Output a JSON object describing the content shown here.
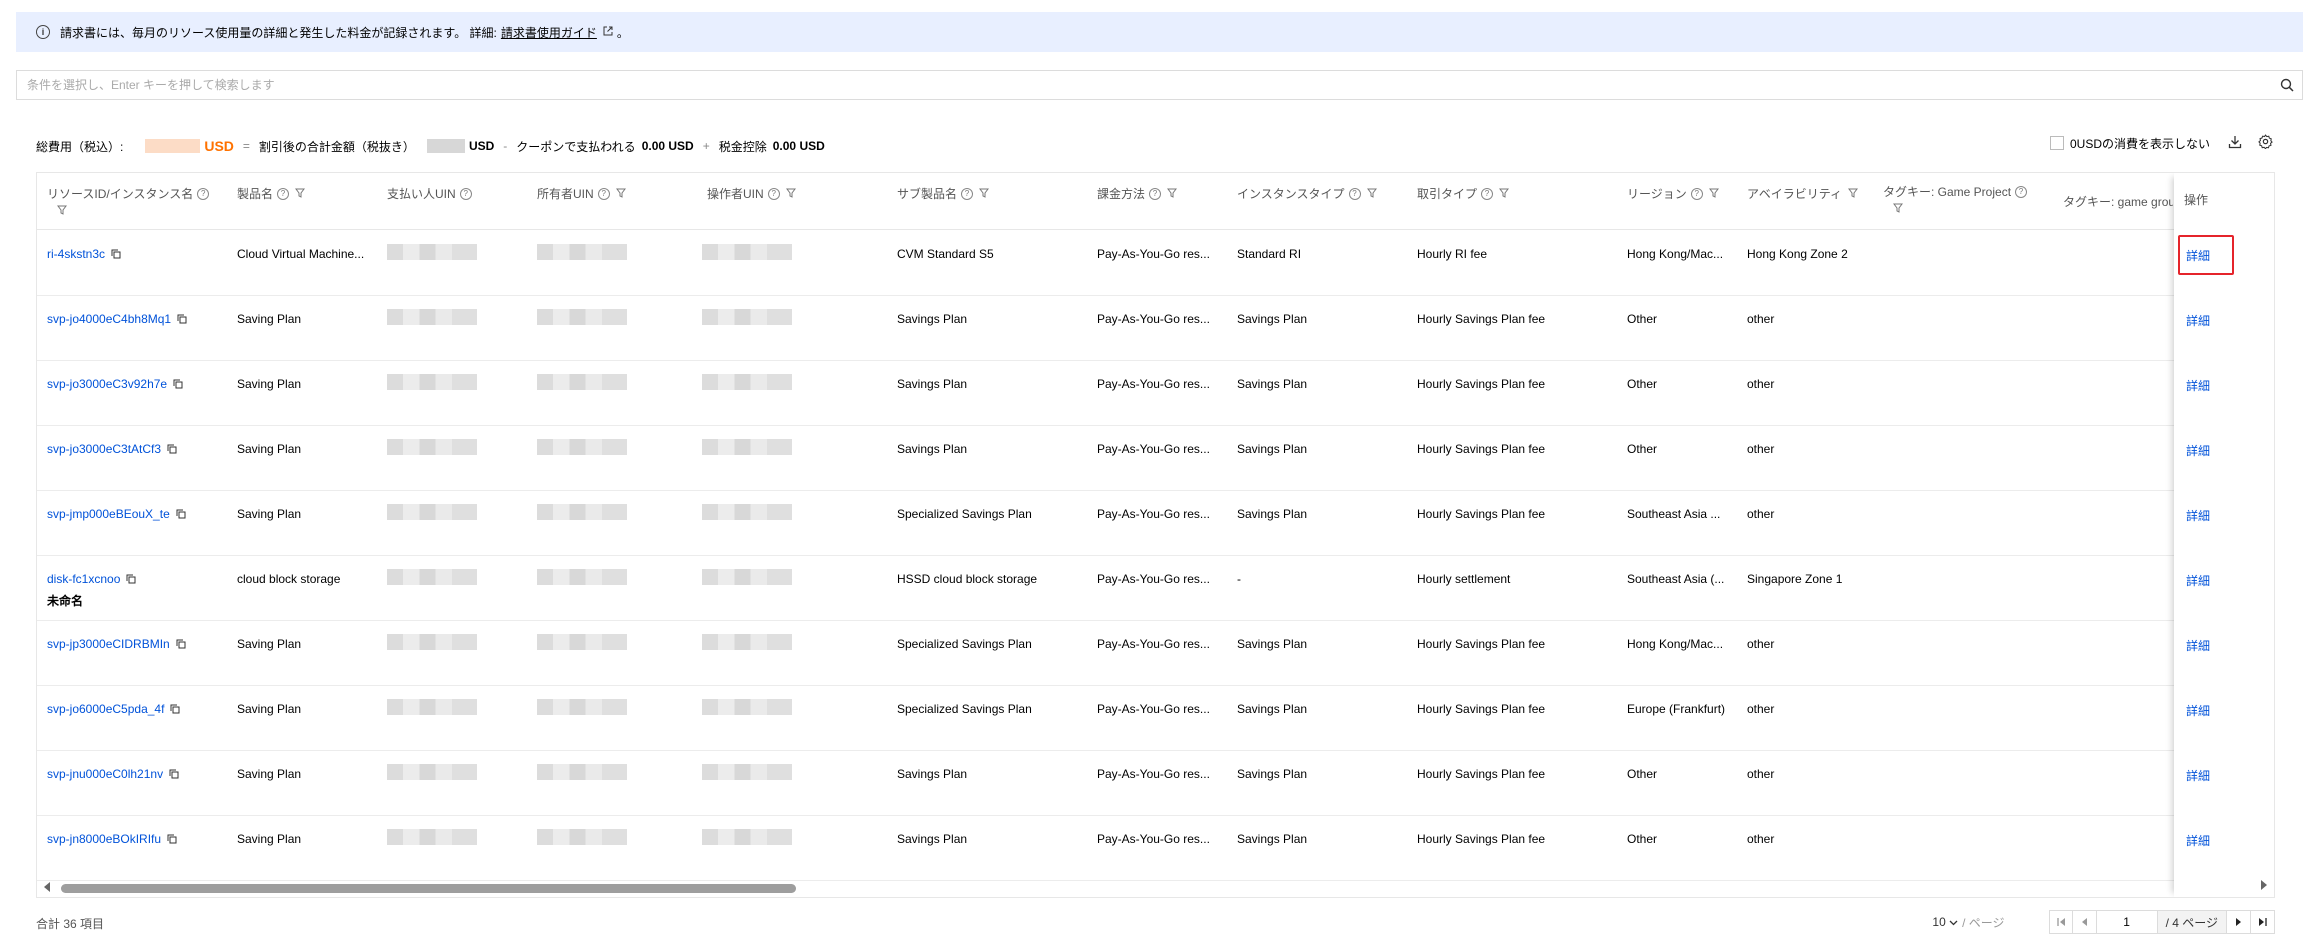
{
  "banner": {
    "text": "請求書には、毎月のリソース使用量の詳細と発生した料金が記録されます。 詳細: ",
    "link": "請求書使用ガイド",
    "end": "。"
  },
  "search": {
    "placeholder": "条件を選択し、Enter キーを押して検索します"
  },
  "summary": {
    "total_label": "総費用（税込）:",
    "total_unit": "USD",
    "eq": "=",
    "discounted_label": "割引後の合計金額（税抜き）",
    "discounted_unit": "USD",
    "minus": "-",
    "coupon_label": "クーポンで支払われる",
    "coupon_value": "0.00 USD",
    "plus": "+",
    "tax_label": "税金控除",
    "tax_value": "0.00 USD"
  },
  "toolbar": {
    "hide_zero_label": "0USDの消費を表示しない",
    "hide_zero_checked": false
  },
  "table": {
    "headers": {
      "resource_id": "リソースID/インスタンス名",
      "product": "製品名",
      "payer_uin": "支払い人UIN",
      "owner_uin": "所有者UIN",
      "operator_uin": "操作者UIN",
      "sub_product": "サブ製品名",
      "billing": "課金方法",
      "instance_type": "インスタンスタイプ",
      "transaction_type": "取引タイプ",
      "region": "リージョン",
      "availability": "アベイラビリティ",
      "tag_game_project": "タグキー: Game Project",
      "tag_game_group": "タグキー: game group",
      "operation": "操作"
    },
    "detail_label": "詳細",
    "rows": [
      {
        "id": "ri-4skstn3c",
        "name": "",
        "product": "Cloud Virtual Machine...",
        "sub_product": "CVM Standard S5",
        "billing": "Pay-As-You-Go res...",
        "instance_type": "Standard RI",
        "transaction_type": "Hourly RI fee",
        "region": "Hong Kong/Mac...",
        "availability": "Hong Kong Zone 2"
      },
      {
        "id": "svp-jo4000eC4bh8Mq1",
        "name": "",
        "product": "Saving Plan",
        "sub_product": "Savings Plan",
        "billing": "Pay-As-You-Go res...",
        "instance_type": "Savings Plan",
        "transaction_type": "Hourly Savings Plan fee",
        "region": "Other",
        "availability": "other"
      },
      {
        "id": "svp-jo3000eC3v92h7e",
        "name": "",
        "product": "Saving Plan",
        "sub_product": "Savings Plan",
        "billing": "Pay-As-You-Go res...",
        "instance_type": "Savings Plan",
        "transaction_type": "Hourly Savings Plan fee",
        "region": "Other",
        "availability": "other"
      },
      {
        "id": "svp-jo3000eC3tAtCf3",
        "name": "",
        "product": "Saving Plan",
        "sub_product": "Savings Plan",
        "billing": "Pay-As-You-Go res...",
        "instance_type": "Savings Plan",
        "transaction_type": "Hourly Savings Plan fee",
        "region": "Other",
        "availability": "other"
      },
      {
        "id": "svp-jmp000eBEouX_te",
        "name": "",
        "product": "Saving Plan",
        "sub_product": "Specialized Savings Plan",
        "billing": "Pay-As-You-Go res...",
        "instance_type": "Savings Plan",
        "transaction_type": "Hourly Savings Plan fee",
        "region": "Southeast Asia ...",
        "availability": "other"
      },
      {
        "id": "disk-fc1xcnoo",
        "name": "未命名",
        "product": "cloud block storage",
        "sub_product": "HSSD cloud block storage",
        "billing": "Pay-As-You-Go res...",
        "instance_type": "-",
        "transaction_type": "Hourly settlement",
        "region": "Southeast Asia (...",
        "availability": "Singapore Zone 1"
      },
      {
        "id": "svp-jp3000eCIDRBMIn",
        "name": "",
        "product": "Saving Plan",
        "sub_product": "Specialized Savings Plan",
        "billing": "Pay-As-You-Go res...",
        "instance_type": "Savings Plan",
        "transaction_type": "Hourly Savings Plan fee",
        "region": "Hong Kong/Mac...",
        "availability": "other"
      },
      {
        "id": "svp-jo6000eC5pda_4f",
        "name": "",
        "product": "Saving Plan",
        "sub_product": "Specialized Savings Plan",
        "billing": "Pay-As-You-Go res...",
        "instance_type": "Savings Plan",
        "transaction_type": "Hourly Savings Plan fee",
        "region": "Europe (Frankfurt)",
        "availability": "other"
      },
      {
        "id": "svp-jnu000eC0lh21nv",
        "name": "",
        "product": "Saving Plan",
        "sub_product": "Savings Plan",
        "billing": "Pay-As-You-Go res...",
        "instance_type": "Savings Plan",
        "transaction_type": "Hourly Savings Plan fee",
        "region": "Other",
        "availability": "other"
      },
      {
        "id": "svp-jn8000eBOkIRIfu",
        "name": "",
        "product": "Saving Plan",
        "sub_product": "Savings Plan",
        "billing": "Pay-As-You-Go res...",
        "instance_type": "Savings Plan",
        "transaction_type": "Hourly Savings Plan fee",
        "region": "Other",
        "availability": "other"
      }
    ]
  },
  "footer": {
    "total": "合計 36 項目",
    "page_size": "10",
    "per_page": "/ ページ",
    "current_page": "1",
    "pages": "/ 4 ページ"
  },
  "icons": [
    "info-icon",
    "external-link-icon",
    "search-icon",
    "download-icon",
    "gear-icon",
    "question-icon",
    "filter-icon",
    "copy-icon",
    "chevron-down-icon",
    "first-page-icon",
    "prev-page-icon",
    "next-page-icon",
    "last-page-icon"
  ],
  "colors": {
    "link": "#0052d9",
    "accent_orange": "#ff7200",
    "banner_bg": "#e8efff",
    "highlight": "#e5242b"
  }
}
